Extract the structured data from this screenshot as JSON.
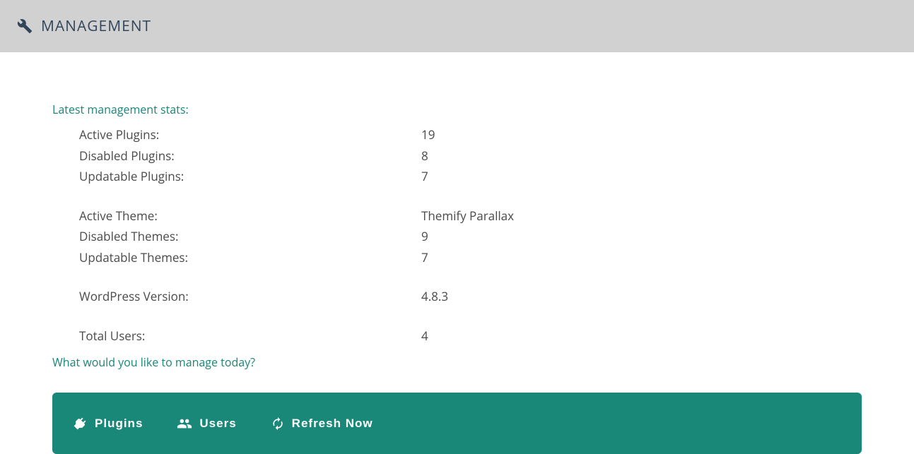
{
  "header": {
    "title": "MANAGEMENT"
  },
  "stats": {
    "heading": "Latest management stats:",
    "rows": [
      {
        "label": "Active Plugins:",
        "value": "19"
      },
      {
        "label": "Disabled Plugins:",
        "value": "8"
      },
      {
        "label": "Updatable Plugins:",
        "value": "7"
      }
    ],
    "rows2": [
      {
        "label": "Active Theme:",
        "value": "Themify Parallax"
      },
      {
        "label": "Disabled Themes:",
        "value": "9"
      },
      {
        "label": "Updatable Themes:",
        "value": "7"
      }
    ],
    "rows3": [
      {
        "label": "WordPress Version:",
        "value": "4.8.3"
      }
    ],
    "rows4": [
      {
        "label": "Total Users:",
        "value": "4"
      }
    ]
  },
  "prompt": "What would you like to manage today?",
  "actions": {
    "plugins": "Plugins",
    "users": "Users",
    "refresh": "Refresh Now"
  }
}
